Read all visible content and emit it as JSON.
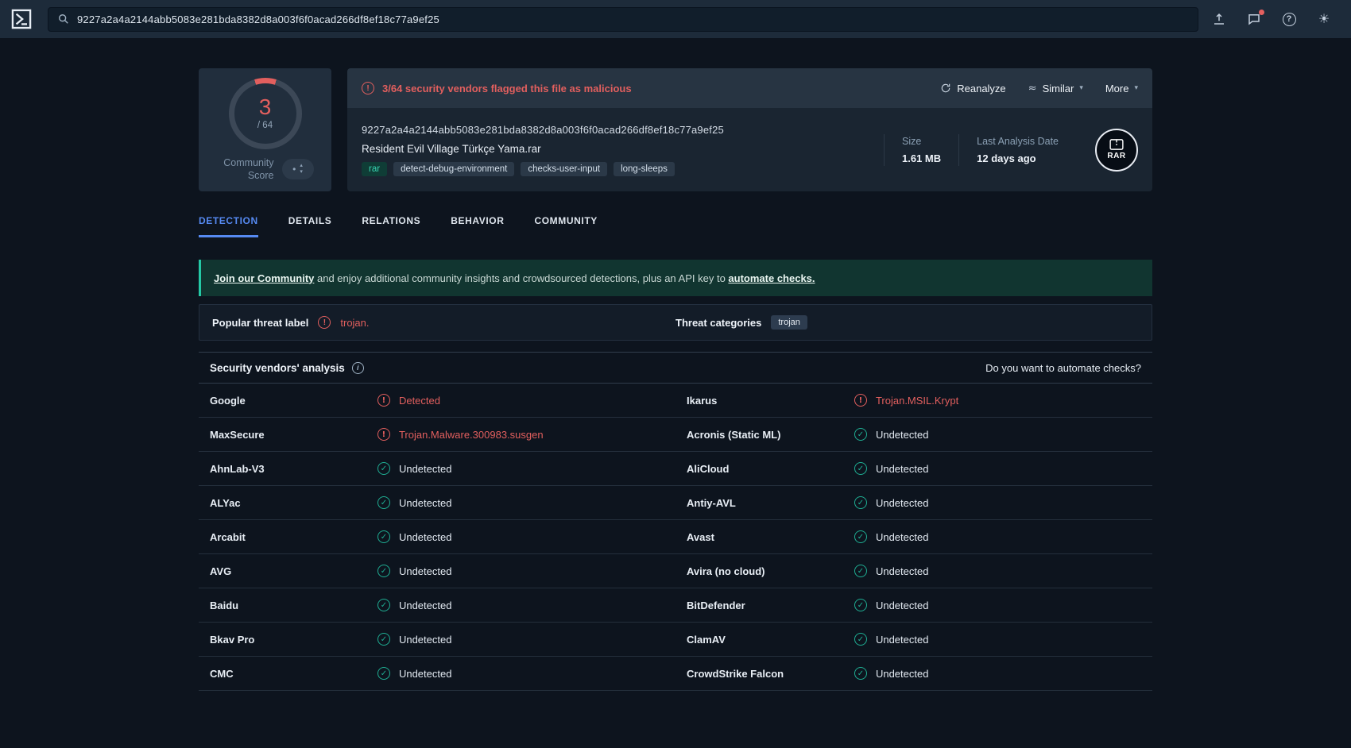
{
  "topbar": {
    "search_value": "9227a2a4a2144abb5083e281bda8382d8a003f6f0acad266df8ef18c77a9ef25"
  },
  "score": {
    "value": "3",
    "total": "/ 64",
    "label": "Community Score"
  },
  "file": {
    "flagged": "3/64 security vendors flagged this file as malicious",
    "actions": {
      "reanalyze": "Reanalyze",
      "similar": "Similar",
      "more": "More"
    },
    "hash": "9227a2a4a2144abb5083e281bda8382d8a003f6f0acad266df8ef18c77a9ef25",
    "name": "Resident Evil Village Türkçe Yama.rar",
    "tags": [
      {
        "label": "rar",
        "kind": "type"
      },
      {
        "label": "detect-debug-environment",
        "kind": "behavior"
      },
      {
        "label": "checks-user-input",
        "kind": "behavior"
      },
      {
        "label": "long-sleeps",
        "kind": "behavior"
      }
    ],
    "size": {
      "label": "Size",
      "value": "1.61 MB"
    },
    "last_analysis": {
      "label": "Last Analysis Date",
      "value": "12 days ago"
    },
    "type_badge": "RAR"
  },
  "tabs": [
    {
      "label": "DETECTION",
      "state": "active"
    },
    {
      "label": "DETAILS",
      "state": "inactive"
    },
    {
      "label": "RELATIONS",
      "state": "inactive"
    },
    {
      "label": "BEHAVIOR",
      "state": "inactive"
    },
    {
      "label": "COMMUNITY",
      "state": "inactive"
    }
  ],
  "banner": {
    "link_community": "Join our Community",
    "text_mid": " and enjoy additional community insights and crowdsourced detections, plus an API key to ",
    "link_automate": "automate checks."
  },
  "threat": {
    "label": "Popular threat label",
    "value": "trojan.",
    "categories_label": "Threat categories",
    "category": "trojan"
  },
  "analysis": {
    "title": "Security vendors' analysis",
    "automate": "Do you want to automate checks?",
    "rows": [
      {
        "cells": [
          {
            "vendor": "Google",
            "result": "Detected",
            "status": "detected"
          },
          {
            "vendor": "Ikarus",
            "result": "Trojan.MSIL.Krypt",
            "status": "detected"
          }
        ]
      },
      {
        "cells": [
          {
            "vendor": "MaxSecure",
            "result": "Trojan.Malware.300983.susgen",
            "status": "detected"
          },
          {
            "vendor": "Acronis (Static ML)",
            "result": "Undetected",
            "status": "undetected"
          }
        ]
      },
      {
        "cells": [
          {
            "vendor": "AhnLab-V3",
            "result": "Undetected",
            "status": "undetected"
          },
          {
            "vendor": "AliCloud",
            "result": "Undetected",
            "status": "undetected"
          }
        ]
      },
      {
        "cells": [
          {
            "vendor": "ALYac",
            "result": "Undetected",
            "status": "undetected"
          },
          {
            "vendor": "Antiy-AVL",
            "result": "Undetected",
            "status": "undetected"
          }
        ]
      },
      {
        "cells": [
          {
            "vendor": "Arcabit",
            "result": "Undetected",
            "status": "undetected"
          },
          {
            "vendor": "Avast",
            "result": "Undetected",
            "status": "undetected"
          }
        ]
      },
      {
        "cells": [
          {
            "vendor": "AVG",
            "result": "Undetected",
            "status": "undetected"
          },
          {
            "vendor": "Avira (no cloud)",
            "result": "Undetected",
            "status": "undetected"
          }
        ]
      },
      {
        "cells": [
          {
            "vendor": "Baidu",
            "result": "Undetected",
            "status": "undetected"
          },
          {
            "vendor": "BitDefender",
            "result": "Undetected",
            "status": "undetected"
          }
        ]
      },
      {
        "cells": [
          {
            "vendor": "Bkav Pro",
            "result": "Undetected",
            "status": "undetected"
          },
          {
            "vendor": "ClamAV",
            "result": "Undetected",
            "status": "undetected"
          }
        ]
      },
      {
        "cells": [
          {
            "vendor": "CMC",
            "result": "Undetected",
            "status": "undetected"
          },
          {
            "vendor": "CrowdStrike Falcon",
            "result": "Undetected",
            "status": "undetected"
          }
        ]
      }
    ]
  }
}
